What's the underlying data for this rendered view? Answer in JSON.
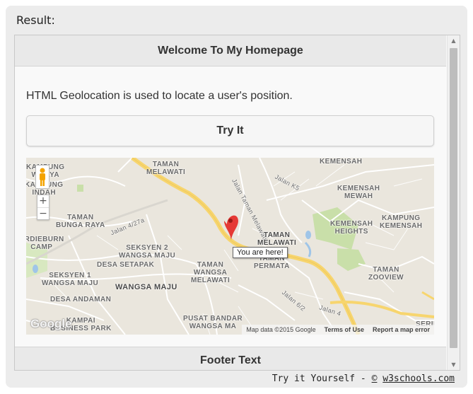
{
  "result_label": "Result:",
  "header": {
    "title": "Welcome To My Homepage"
  },
  "content": {
    "paragraph": "HTML Geolocation is used to locate a user's position.",
    "try_button": "Try It"
  },
  "map": {
    "labels": {
      "kampung_wijaya": "KAMPUNG\nWIJAYA",
      "kampung_indah": "KAMPUNG\nINDAH",
      "taman_melawati_north": "TAMAN\nMELAWATI",
      "jalan_taman_melawati": "Jalan Taman Melawati",
      "jalan_k5": "Jalan K5",
      "kemensah": "KEMENSAH",
      "kemensah_mewah": "KEMENSAH\nMEWAH",
      "taman_bunga_raya": "TAMAN\nBUNGA RAYA",
      "jalan_4_27a": "Jalan 4/27a",
      "ardieburn_camp": "ARDIEBURN\nCAMP",
      "seksyen_2": "SEKSYEN 2\nWANGSA MAJU",
      "taman_melawati_center": "TAMAN\nMELAWATI",
      "kemensah_heights": "KEMENSAH\nHEIGHTS",
      "kampung_kemensah": "KAMPUNG\nKEMENSAH",
      "desa_setapak": "DESA SETAPAK",
      "taman_permata": "TAMAN\nPERMATA",
      "seksyen_1": "SEKSYEN 1\nWANGSA MAJU",
      "taman_wangsa_melawati": "TAMAN\nWANGSA\nMELAWATI",
      "taman_zooview": "TAMAN\nZOOVIEW",
      "wangsa_maju": "WANGSA MAJU",
      "desa_andaman": "DESA ANDAMAN",
      "jalan_6_2": "Jalan 6/2",
      "jalan_4": "Jalan 4",
      "kampai_business_park": "KAMPAI\nBUSINESS PARK",
      "pusat_bandar": "PUSAT BANDAR\nWANGSA MA",
      "serin": "SERIN"
    },
    "tooltip": "You are here!",
    "google_logo": "Google",
    "attribution": {
      "map_data": "Map data ©2015 Google",
      "terms": "Terms of Use",
      "report": "Report a map error"
    },
    "zoom_in": "+",
    "zoom_out": "−",
    "colors": {
      "land": "#eae6dd",
      "major_road": "#f7d56e",
      "minor_road": "#ffffff",
      "park": "#c9dfa9",
      "water": "#9fc5e8",
      "marker": "#e53935"
    }
  },
  "footer": {
    "text": "Footer Text"
  },
  "credit": {
    "prefix": "Try it Yourself - ",
    "copyright": "©",
    "site": "w3schools.com"
  }
}
